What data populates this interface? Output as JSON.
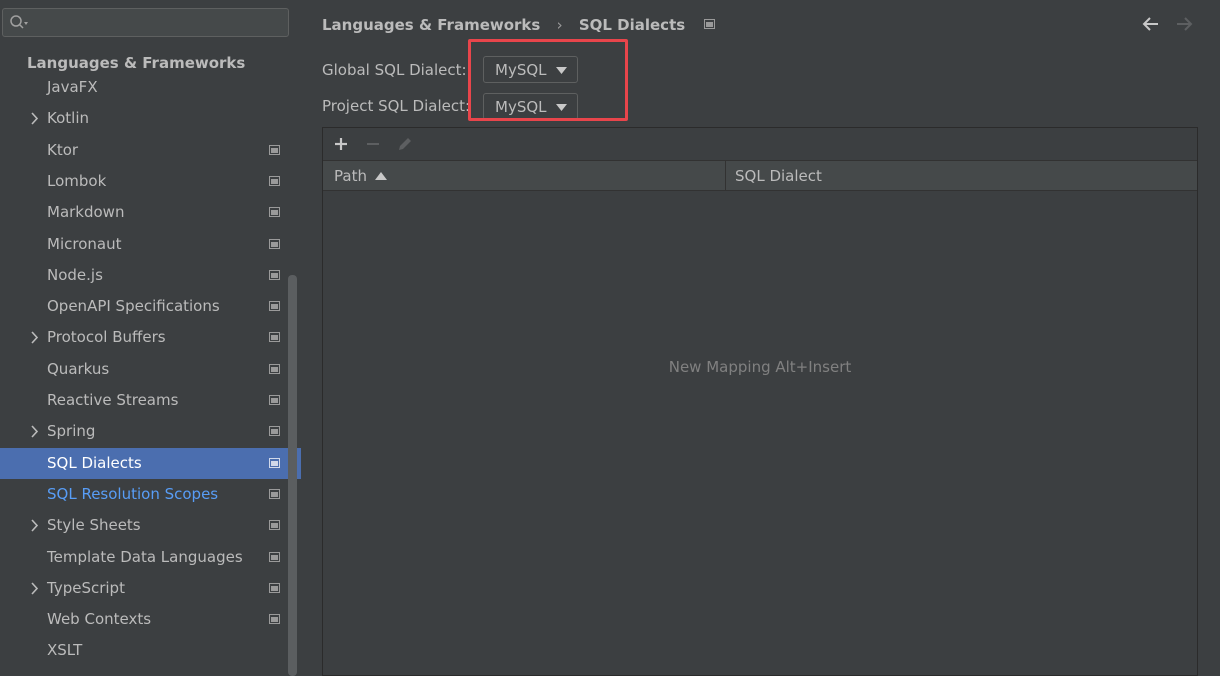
{
  "sidebar": {
    "search_placeholder": "",
    "group_header": "Languages & Frameworks",
    "items": [
      {
        "label": "JavaFX",
        "expandable": false,
        "project_icon": false
      },
      {
        "label": "Kotlin",
        "expandable": true,
        "project_icon": false
      },
      {
        "label": "Ktor",
        "expandable": false,
        "project_icon": true
      },
      {
        "label": "Lombok",
        "expandable": false,
        "project_icon": true
      },
      {
        "label": "Markdown",
        "expandable": false,
        "project_icon": true
      },
      {
        "label": "Micronaut",
        "expandable": false,
        "project_icon": true
      },
      {
        "label": "Node.js",
        "expandable": false,
        "project_icon": true
      },
      {
        "label": "OpenAPI Specifications",
        "expandable": false,
        "project_icon": true
      },
      {
        "label": "Protocol Buffers",
        "expandable": true,
        "project_icon": true
      },
      {
        "label": "Quarkus",
        "expandable": false,
        "project_icon": true
      },
      {
        "label": "Reactive Streams",
        "expandable": false,
        "project_icon": true
      },
      {
        "label": "Spring",
        "expandable": true,
        "project_icon": true
      },
      {
        "label": "SQL Dialects",
        "expandable": false,
        "project_icon": true,
        "selected": true
      },
      {
        "label": "SQL Resolution Scopes",
        "expandable": false,
        "project_icon": true,
        "link": true
      },
      {
        "label": "Style Sheets",
        "expandable": true,
        "project_icon": true
      },
      {
        "label": "Template Data Languages",
        "expandable": false,
        "project_icon": true
      },
      {
        "label": "TypeScript",
        "expandable": true,
        "project_icon": true
      },
      {
        "label": "Web Contexts",
        "expandable": false,
        "project_icon": true
      },
      {
        "label": "XSLT",
        "expandable": false,
        "project_icon": false
      }
    ]
  },
  "breadcrumb": {
    "parent": "Languages & Frameworks",
    "current": "SQL Dialects"
  },
  "form": {
    "global_label": "Global SQL Dialect:",
    "global_value": "MySQL",
    "project_label": "Project SQL Dialect:",
    "project_value": "MySQL"
  },
  "table": {
    "columns": [
      "Path",
      "SQL Dialect"
    ],
    "empty_text": "New Mapping Alt+Insert"
  },
  "colors": {
    "background": "#3c3f41",
    "selection": "#4b6eaf",
    "link": "#589df6",
    "highlight_border": "#e8454b",
    "add_icon": "#c8c8c8"
  }
}
